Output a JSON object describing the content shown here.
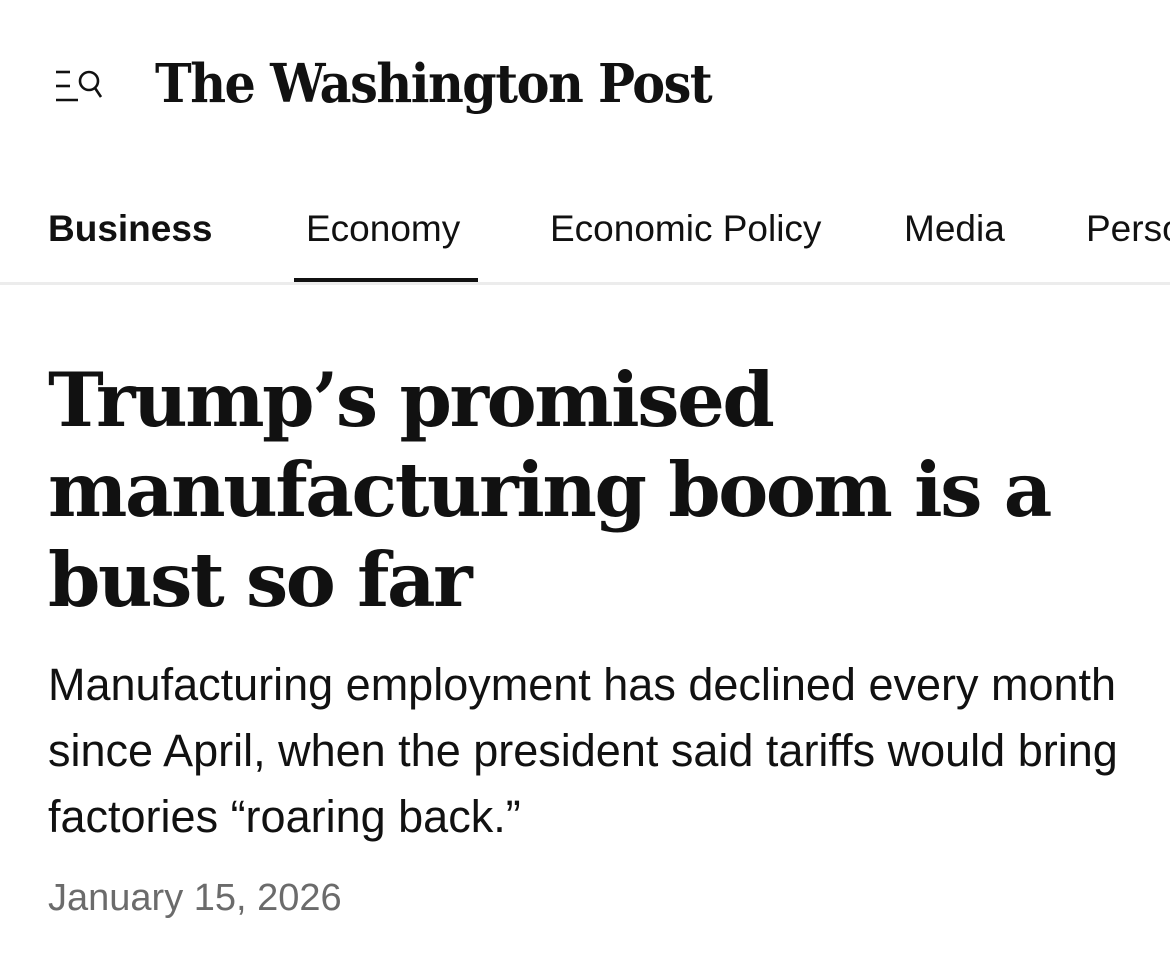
{
  "header": {
    "menu_icon": "menu-search-icon",
    "logo_text": "The Washington Post"
  },
  "nav": {
    "items": [
      {
        "label": "Business"
      },
      {
        "label": "Economy"
      },
      {
        "label": "Economic Policy"
      },
      {
        "label": "Media"
      },
      {
        "label": "Perso"
      }
    ],
    "active_item": "Economy"
  },
  "article": {
    "headline": "Trump’s promised manufacturing boom is a bust so far",
    "dek": "Manufacturing employment has declined every month since April, when the president said tariffs would bring factories “roaring back.”",
    "date": "January 15, 2026"
  },
  "colors": {
    "text": "#111111",
    "muted": "#6b6b6b",
    "divider": "#ececec"
  }
}
